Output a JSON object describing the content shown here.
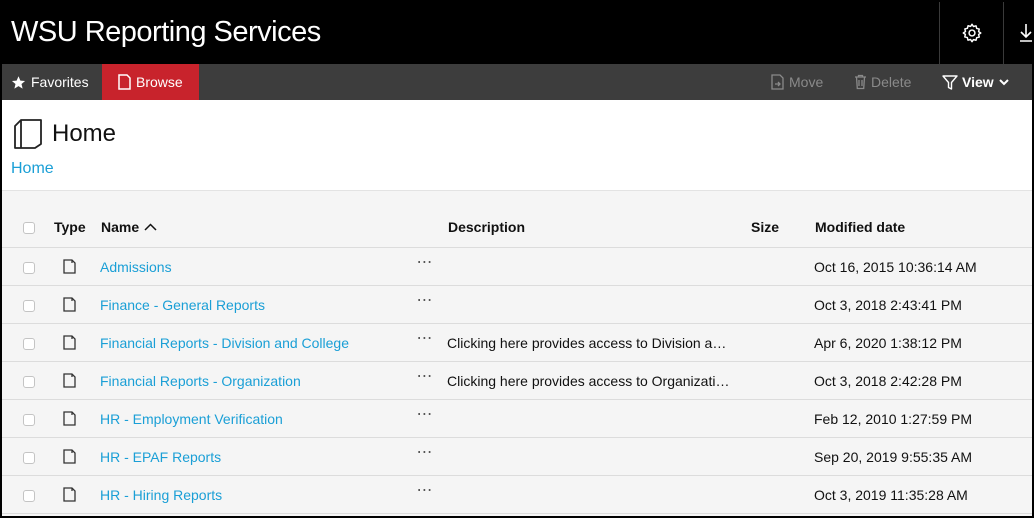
{
  "app": {
    "title": "WSU Reporting Services"
  },
  "icons": {
    "settings": "gear-icon",
    "download": "download-icon",
    "favorites": "star-icon",
    "browse": "document-icon",
    "move": "move-icon",
    "delete": "trash-icon",
    "view": "filter-icon",
    "home": "folder-icon",
    "sort": "chevron-up-icon"
  },
  "colors": {
    "accent": "#c8232c",
    "link": "#1a9fd6",
    "titlebar": "#000000",
    "toolbar": "#3d3d3d"
  },
  "toolbar": {
    "favorites_label": "Favorites",
    "browse_label": "Browse",
    "move_label": "Move",
    "delete_label": "Delete",
    "view_label": "View"
  },
  "page": {
    "title": "Home",
    "breadcrumb": "Home"
  },
  "table": {
    "headers": {
      "type": "Type",
      "name": "Name",
      "description": "Description",
      "size": "Size",
      "modified": "Modified date"
    },
    "rows": [
      {
        "name": "Admissions",
        "more": "⋯",
        "description": "",
        "modified": "Oct 16, 2015 10:36:14 AM"
      },
      {
        "name": "Finance - General Reports",
        "more": "⋯",
        "description": "",
        "modified": "Oct 3, 2018 2:43:41 PM"
      },
      {
        "name": "Financial Reports - Division and College",
        "more": "⋯",
        "description": "Clicking here provides access to Division a…",
        "modified": "Apr 6, 2020 1:38:12 PM"
      },
      {
        "name": "Financial Reports - Organization",
        "more": "⋯",
        "description": "Clicking here provides access to Organizati…",
        "modified": "Oct 3, 2018 2:42:28 PM"
      },
      {
        "name": "HR - Employment Verification",
        "more": "⋯",
        "description": "",
        "modified": "Feb 12, 2010 1:27:59 PM"
      },
      {
        "name": "HR - EPAF Reports",
        "more": "⋯",
        "description": "",
        "modified": "Sep 20, 2019 9:55:35 AM"
      },
      {
        "name": "HR - Hiring Reports",
        "more": "⋯",
        "description": "",
        "modified": "Oct 3, 2019 11:35:28 AM"
      }
    ]
  }
}
